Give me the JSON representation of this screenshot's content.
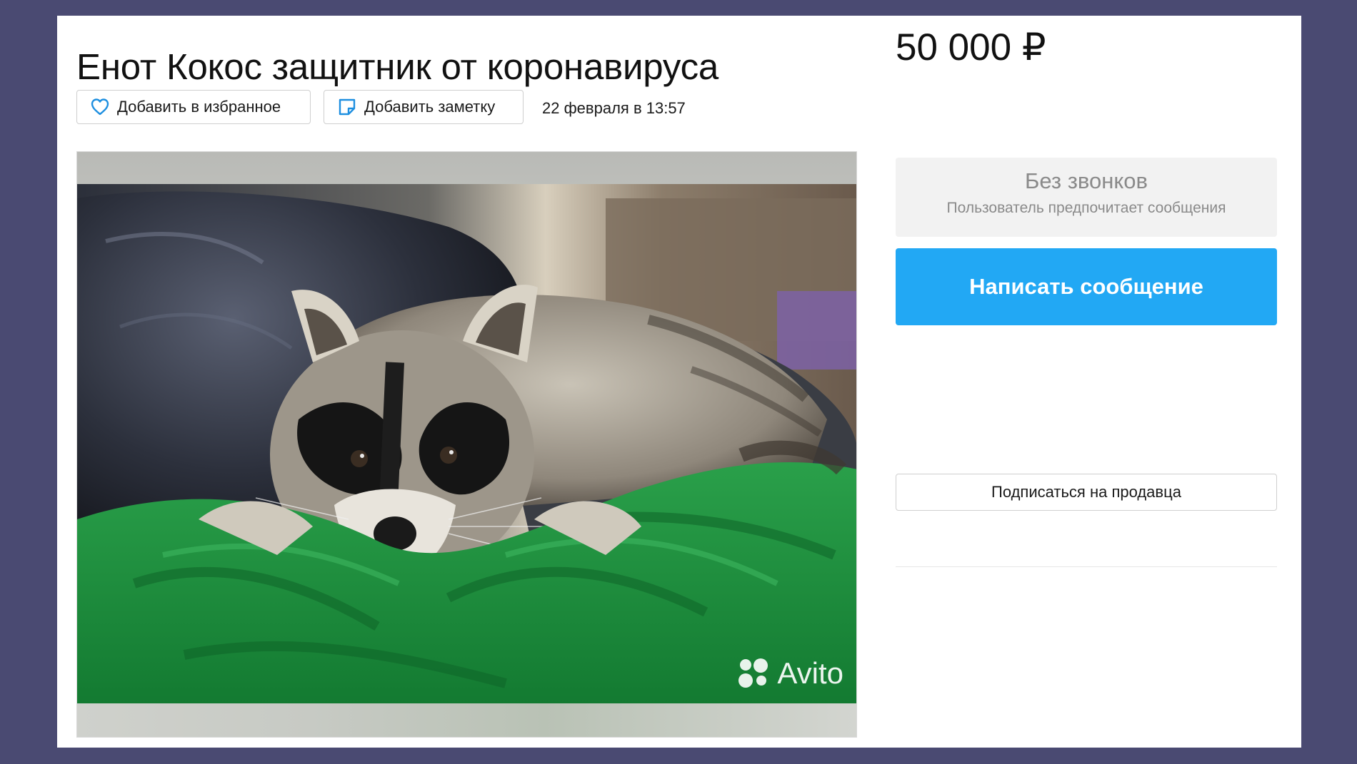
{
  "listing": {
    "title": "Енот Кокос защитник от коронавируса",
    "price": "50 000 ₽",
    "date": "22 февраля в 13:57"
  },
  "actions": {
    "favorite_label": "Добавить в избранное",
    "note_label": "Добавить заметку"
  },
  "gallery": {
    "watermark": "Avito",
    "photo_subject": "raccoon"
  },
  "contact": {
    "calls_title": "Без звонков",
    "calls_subtitle": "Пользователь предпочитает сообщения",
    "message_button": "Написать сообщение",
    "subscribe_button": "Подписаться на продавца"
  },
  "colors": {
    "primary_button": "#22a8f4",
    "frame_background": "#4a4a72",
    "favorite_icon": "#1e8fe0"
  },
  "icons": {
    "favorite": "heart-outline-icon",
    "note": "sticky-note-icon",
    "watermark_logo": "avito-dots-logo"
  }
}
